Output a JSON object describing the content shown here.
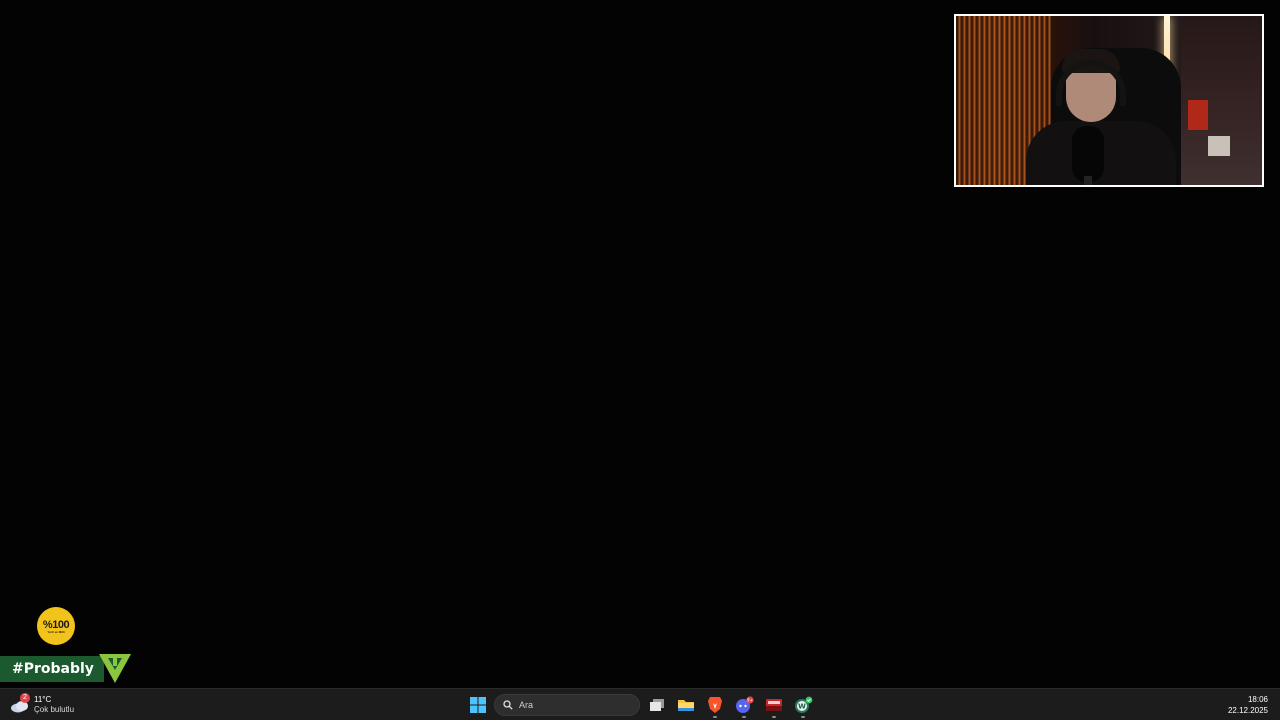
{
  "overlay": {
    "badge": {
      "text": "%100",
      "subtext": "Yerli ve Milli"
    },
    "banner": {
      "text": "#Probably",
      "logo_color": "#8cc63f",
      "bg_color": "#1a5a2e"
    }
  },
  "taskbar": {
    "weather": {
      "temperature": "11°C",
      "condition": "Çok bulutlu",
      "notification_count": "2"
    },
    "search": {
      "placeholder": "Ara"
    },
    "apps": [
      {
        "name": "task-view",
        "icon": "task-view-icon"
      },
      {
        "name": "file-explorer",
        "icon": "folder-icon"
      },
      {
        "name": "brave-browser",
        "icon": "brave-lion-icon"
      },
      {
        "name": "discord",
        "icon": "discord-icon",
        "badge": "9+"
      },
      {
        "name": "obs-style-app",
        "icon": "red-app-icon"
      },
      {
        "name": "whatsapp-web",
        "icon": "w-icon"
      }
    ],
    "clock": {
      "time": "18:06",
      "date": "22.12.2025"
    }
  }
}
